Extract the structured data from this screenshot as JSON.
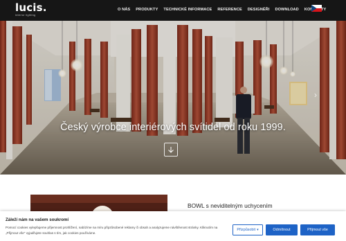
{
  "header": {
    "logo": "lucis.",
    "tagline": "interior lighting",
    "nav": [
      "O NÁS",
      "PRODUKTY",
      "TECHNICKÉ INFORMACE",
      "REFERENCE",
      "DESIGNÉŘI",
      "DOWNLOAD",
      "KONTAKTY"
    ],
    "language_icon": "czech-flag-icon"
  },
  "hero": {
    "title": "Český výrobce interiérových svítidel od roku 1999.",
    "scroll_icon": "arrow-down-icon",
    "next_icon": "chevron-right-icon"
  },
  "product": {
    "title": "BOWL s neviditelným uchycením"
  },
  "cookie": {
    "title": "Záleží nám na vašem soukromí",
    "text": "Pomocí cookies vylepšujeme přijemnost prohlížení, nabízíme na míru připzůsobené reklamy či obsah a analyzujeme návštěvnost stránky. Kliknutím na „Přijmout vše\" vyjadřujete souhlas s tím, jak cookies používáme.",
    "customize_label": "Přizpůsobit",
    "reject_label": "Odmítnout",
    "accept_label": "Přijmout vše"
  },
  "colors": {
    "header_bg": "#161616",
    "accent": "#1e63c6",
    "marble": "#a03a26"
  }
}
